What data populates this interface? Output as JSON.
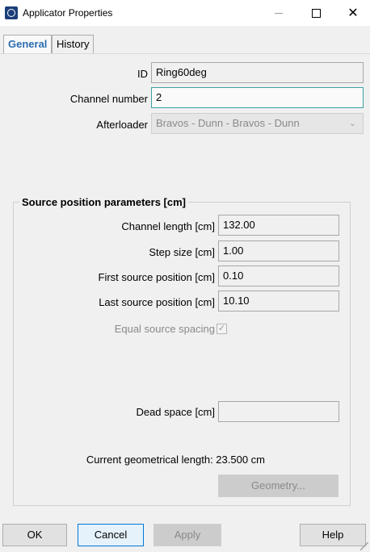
{
  "window": {
    "title": "Applicator Properties",
    "close_glyph": "✕"
  },
  "tabs": [
    {
      "label": "General",
      "active": true
    },
    {
      "label": "History",
      "active": false
    }
  ],
  "general": {
    "id_label": "ID",
    "id_value": "Ring60deg",
    "channel_number_label": "Channel number",
    "channel_number_value": "2",
    "afterloader_label": "Afterloader",
    "afterloader_value": "Bravos - Dunn - Bravos - Dunn"
  },
  "source_position": {
    "group_title": "Source position parameters [cm]",
    "channel_length_label": "Channel length [cm]",
    "channel_length_value": "132.00",
    "step_size_label": "Step size [cm]",
    "step_size_value": "1.00",
    "first_source_label": "First source position [cm]",
    "first_source_value": "0.10",
    "last_source_label": "Last source position [cm]",
    "last_source_value": "10.10",
    "equal_spacing_label": "Equal source spacing",
    "equal_spacing_checked": true,
    "dead_space_label": "Dead space [cm]",
    "dead_space_value": "",
    "geom_length_text": "Current geometrical length: 23.500 cm",
    "geometry_button": "Geometry..."
  },
  "footer": {
    "ok": "OK",
    "cancel": "Cancel",
    "apply": "Apply",
    "help": "Help"
  },
  "colors": {
    "accent": "#2b6cb0",
    "focus_border": "#3fa0a0",
    "default_button_border": "#0078d7"
  }
}
